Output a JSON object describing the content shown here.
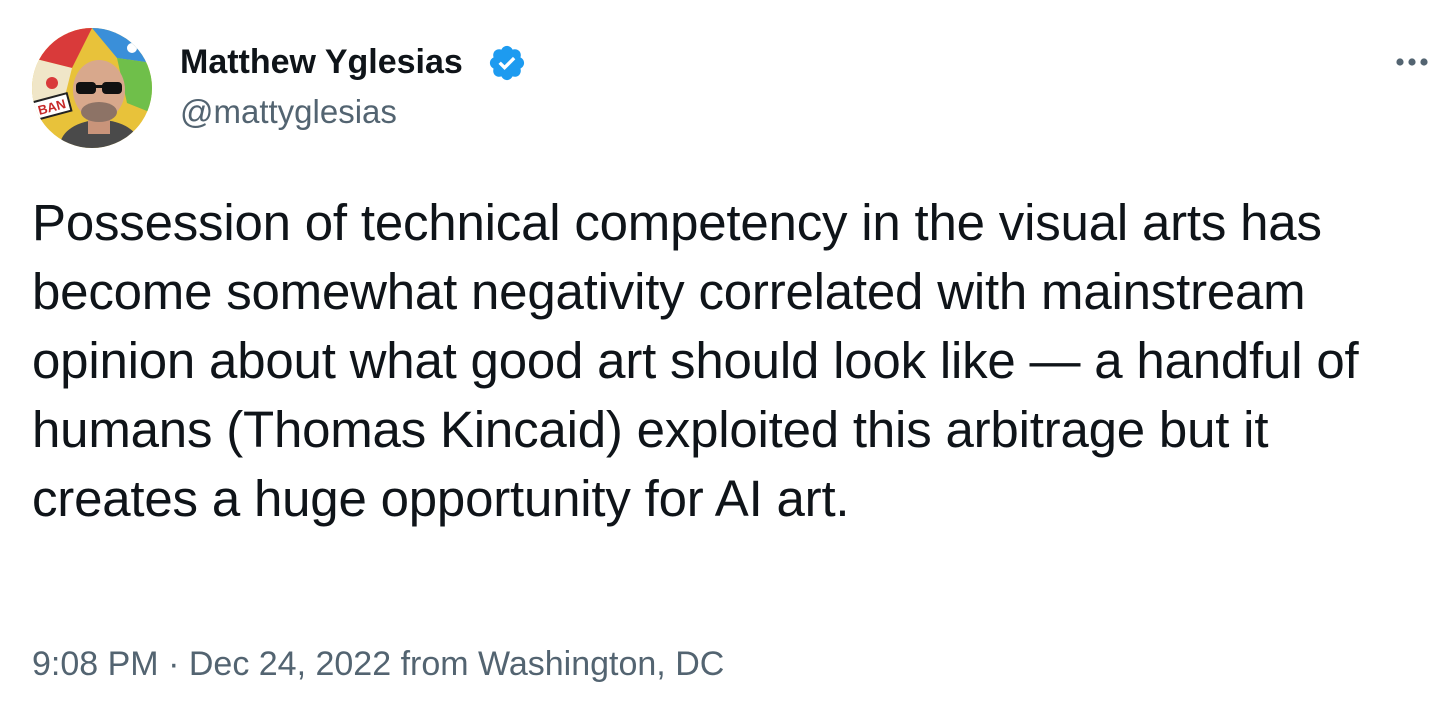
{
  "tweet": {
    "author": {
      "name": "Matthew Yglesias",
      "handle": "@mattyglesias",
      "verified": true,
      "avatar_badge_text": "BAN"
    },
    "more_icon": "more-horizontal-icon",
    "text": "Possession of technical competency in the visual arts has become somewhat negativity correlated with mainstream opinion about what good art should look like — a handful of humans (Thomas Kincaid) exploited this arbitrage but it creates a huge opportunity for AI art.",
    "time": "9:08 PM",
    "separator": "·",
    "date": "Dec 24, 2022",
    "source": "from Washington, DC"
  },
  "colors": {
    "text": "#0f1419",
    "secondary": "#536471",
    "verified_badge": "#1d9bf0",
    "background": "#ffffff"
  }
}
